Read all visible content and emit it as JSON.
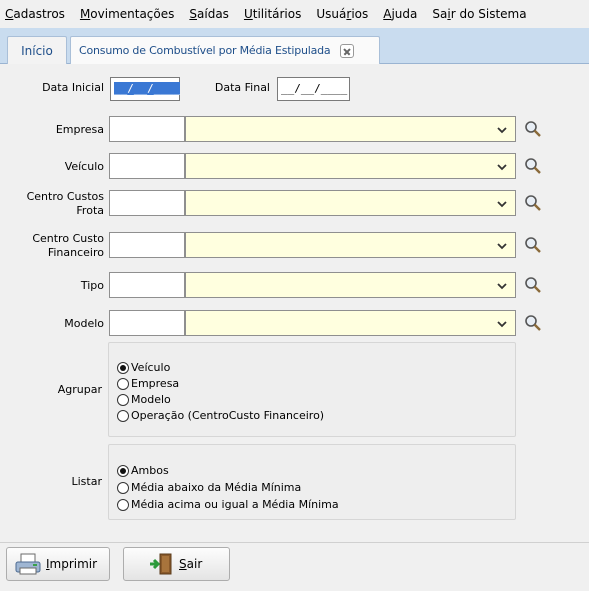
{
  "menu": [
    {
      "accel": "C",
      "rest": "adastros"
    },
    {
      "accel": "M",
      "rest": "ovimentações"
    },
    {
      "accel": "S",
      "rest": "aídas"
    },
    {
      "accel": "U",
      "rest": "tilitários"
    },
    {
      "pre": "Usuá",
      "accel": "r",
      "rest": "ios"
    },
    {
      "accel": "A",
      "rest": "juda"
    },
    {
      "pre": "Sa",
      "accel": "i",
      "rest": "r do Sistema"
    }
  ],
  "tabs": {
    "home": "Início",
    "active": "Consumo de Combustível por Média Estipulada"
  },
  "dates": {
    "start_label": "Data Inicial",
    "start_value": "__/__/____",
    "end_label": "Data Final",
    "end_value": "__/__/____"
  },
  "fields": {
    "empresa": "Empresa",
    "veiculo": "Veículo",
    "centro_frota_1": "Centro Custos",
    "centro_frota_2": "Frota",
    "centro_fin_1": "Centro Custo",
    "centro_fin_2": "Financeiro",
    "tipo": "Tipo",
    "modelo": "Modelo"
  },
  "agrupar": {
    "label": "Agrupar",
    "options": [
      "Veículo",
      "Empresa",
      "Modelo",
      "Operação (CentroCusto Financeiro)"
    ],
    "selected_index": 0
  },
  "listar": {
    "label": "Listar",
    "options": [
      "Ambos",
      "Média abaixo da Média Mínima",
      "Média acima ou igual a Média Mínima"
    ],
    "selected_index": 0
  },
  "buttons": {
    "print": {
      "accel": "I",
      "rest": "mprimir"
    },
    "exit": {
      "accel": "S",
      "rest": "air"
    }
  },
  "colors": {
    "combo_bg": "#ffffdf",
    "tab_strip": "#c9dcef",
    "selection": "#3a78d4"
  }
}
